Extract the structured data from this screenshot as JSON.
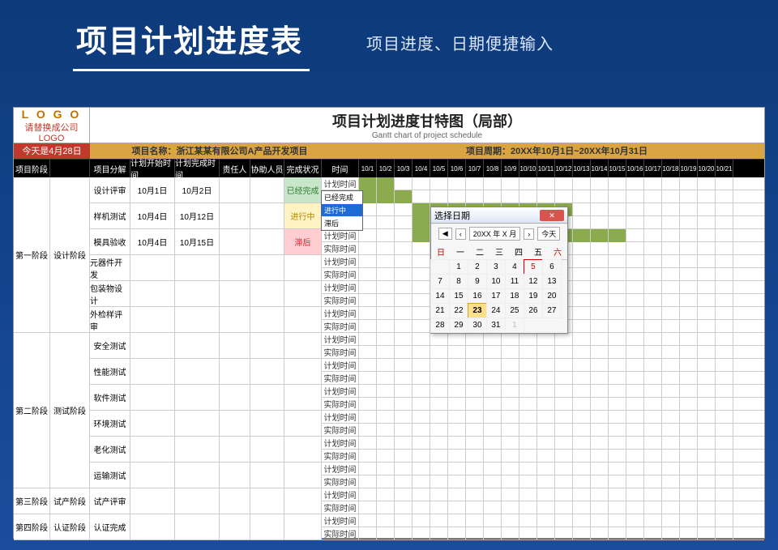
{
  "banner": {
    "title": "项目计划进度表",
    "subtitle": "项目进度、日期便捷输入"
  },
  "sheet": {
    "logo": {
      "text": "L O G O",
      "sub": "请替换成公司LOGO"
    },
    "title": {
      "zh": "项目计划进度甘特图（局部）",
      "en": "Gantt chart of project schedule"
    },
    "dateBanner": {
      "left": "今天是4月28日",
      "mid": "项目名称：浙江某某有限公司A产品开发项目",
      "right": "项目周期：20XX年10月1日~20XX年10月31日"
    },
    "columns": {
      "stage": "项目阶段",
      "phase": "",
      "task": "项目分解",
      "start": "计划开始时间",
      "end": "计划完成时间",
      "owner": "责任人",
      "asst": "协助人员",
      "status": "完成状况",
      "time": "时间"
    },
    "days": [
      "10/1",
      "10/2",
      "10/3",
      "10/4",
      "10/5",
      "10/6",
      "10/7",
      "10/8",
      "10/9",
      "10/10",
      "10/11",
      "10/12",
      "10/13",
      "10/14",
      "10/15",
      "10/16",
      "10/17",
      "10/18",
      "10/19",
      "10/20",
      "10/21"
    ],
    "timeLabels": {
      "plan": "计划时间",
      "actual": "实际时间"
    }
  },
  "stages": [
    {
      "stage": "第一阶段",
      "phase": "设计阶段",
      "tasks": [
        {
          "name": "设计评审",
          "start": "10月1日",
          "end": "10月2日",
          "status": "已经完成",
          "statusCls": "status-done",
          "bars": {
            "plan": [
              0,
              1
            ],
            "actual": [
              0,
              2
            ]
          }
        },
        {
          "name": "样机测试",
          "start": "10月4日",
          "end": "10月12日",
          "status": "进行中",
          "statusCls": "status-doing",
          "bars": {
            "plan": [
              3,
              11
            ],
            "actual": [
              3,
              7
            ]
          }
        },
        {
          "name": "模具验收",
          "start": "10月4日",
          "end": "10月15日",
          "status": "滞后",
          "statusCls": "status-late",
          "bars": {
            "plan": [
              3,
              14
            ],
            "actual": []
          }
        },
        {
          "name": "元器件开发",
          "start": "",
          "end": "",
          "status": "",
          "statusCls": "",
          "bars": {
            "plan": [],
            "actual": []
          }
        },
        {
          "name": "包装物设计",
          "start": "",
          "end": "",
          "status": "",
          "statusCls": "",
          "bars": {
            "plan": [],
            "actual": []
          }
        },
        {
          "name": "外检样评审",
          "start": "",
          "end": "",
          "status": "",
          "statusCls": "",
          "bars": {
            "plan": [],
            "actual": []
          }
        }
      ]
    },
    {
      "stage": "第二阶段",
      "phase": "测试阶段",
      "tasks": [
        {
          "name": "安全测试",
          "start": "",
          "end": "",
          "status": "",
          "statusCls": "",
          "bars": {
            "plan": [],
            "actual": []
          }
        },
        {
          "name": "性能测试",
          "start": "",
          "end": "",
          "status": "",
          "statusCls": "",
          "bars": {
            "plan": [],
            "actual": []
          }
        },
        {
          "name": "软件测试",
          "start": "",
          "end": "",
          "status": "",
          "statusCls": "",
          "bars": {
            "plan": [],
            "actual": []
          }
        },
        {
          "name": "环境测试",
          "start": "",
          "end": "",
          "status": "",
          "statusCls": "",
          "bars": {
            "plan": [],
            "actual": []
          }
        },
        {
          "name": "老化测试",
          "start": "",
          "end": "",
          "status": "",
          "statusCls": "",
          "bars": {
            "plan": [],
            "actual": []
          }
        },
        {
          "name": "运输测试",
          "start": "",
          "end": "",
          "status": "",
          "statusCls": "",
          "bars": {
            "plan": [],
            "actual": []
          }
        }
      ]
    },
    {
      "stage": "第三阶段",
      "phase": "试产阶段",
      "tasks": [
        {
          "name": "试产评审",
          "start": "",
          "end": "",
          "status": "",
          "statusCls": "",
          "bars": {
            "plan": [],
            "actual": []
          }
        }
      ]
    },
    {
      "stage": "第四阶段",
      "phase": "认证阶段",
      "tasks": [
        {
          "name": "认证完成",
          "start": "",
          "end": "",
          "status": "",
          "statusCls": "",
          "bars": {
            "plan": [],
            "actual": []
          }
        }
      ]
    }
  ],
  "dropdown": {
    "options": [
      "已经完成",
      "进行中",
      "滞后"
    ],
    "selected": 1
  },
  "calendar": {
    "title": "选择日期",
    "navLabel": "20XX 年 X 月",
    "todayBtn": "今天",
    "week": [
      "日",
      "一",
      "二",
      "三",
      "四",
      "五",
      "六"
    ],
    "leading": [
      ""
    ],
    "days": [
      1,
      2,
      3,
      4,
      5,
      6,
      7,
      8,
      9,
      10,
      11,
      12,
      13,
      14,
      15,
      16,
      17,
      18,
      19,
      20,
      21,
      22,
      23,
      24,
      25,
      26,
      27,
      28,
      29,
      30,
      31
    ],
    "trailing": [
      1
    ],
    "today": 23,
    "selected": 5
  }
}
